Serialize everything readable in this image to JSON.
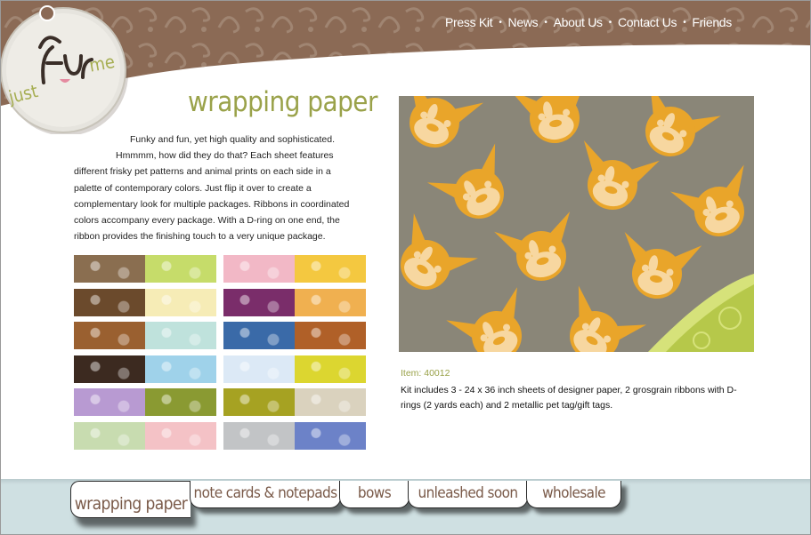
{
  "logo": {
    "text": "just fur me"
  },
  "topnav": {
    "items": [
      "Press Kit",
      "News",
      "About Us",
      "Contact Us",
      "Friends"
    ],
    "separator": "•"
  },
  "main": {
    "title": "wrapping paper",
    "intro_lines": [
      "Funky and fun, yet high quality and sophisticated.",
      "Hmmmm, how did they do that? Each sheet features",
      "different frisky pet patterns and animal prints on each side in a",
      "palette of contemporary colors. Just flip it over to create a",
      "complementary look for multiple packages. Ribbons in coordinated",
      "colors accompany every package. With a D-ring on one end, the",
      "ribbon provides the finishing touch to a very unique package."
    ],
    "item_number": "Item: 40012",
    "item_description": "Kit includes 3 - 24 x 36 inch sheets of designer paper, 2 grosgrain ribbons with D-rings (2 yards each) and 2 metallic pet tag/gift tags."
  },
  "swatches": [
    [
      "#8a6e50",
      "#c6dc6a"
    ],
    [
      "#f2b8c6",
      "#f4c840"
    ],
    [
      "#6b4a2c",
      "#f6ecb6"
    ],
    [
      "#7a2d6a",
      "#f0b050"
    ],
    [
      "#9a6030",
      "#bfe2dc"
    ],
    [
      "#3a6aa8",
      "#b06028"
    ],
    [
      "#3c2a20",
      "#9fd2ea"
    ],
    [
      "#dce9f6",
      "#dcd630"
    ],
    [
      "#b89ad2",
      "#8a9a32"
    ],
    [
      "#a6a222",
      "#dad2be"
    ],
    [
      "#c8dcb0",
      "#f4c2c6"
    ],
    [
      "#c2c4c6",
      "#6c82c8"
    ]
  ],
  "bottom_nav": {
    "tabs": [
      "wrapping paper",
      "note cards & notepads",
      "bows",
      "unleashed soon",
      "wholesale"
    ],
    "active": "wrapping paper"
  },
  "colors": {
    "header_brown": "#8b6a55",
    "title_green": "#9aa24a",
    "footer_blue": "#cfe0e2",
    "pattern_gray": "#8a8678",
    "pattern_orange": "#e9a52a"
  }
}
